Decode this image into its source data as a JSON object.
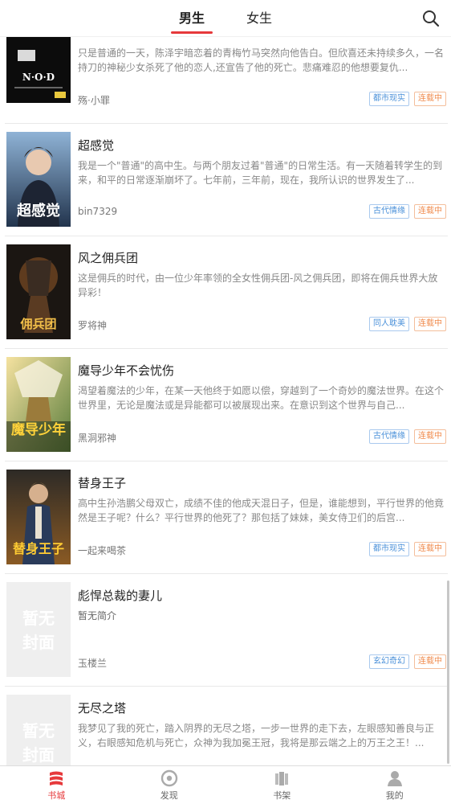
{
  "header": {
    "tabs": [
      {
        "label": "男生",
        "active": true
      },
      {
        "label": "女生",
        "active": false
      }
    ],
    "search_icon": "search-icon"
  },
  "books": [
    {
      "title": "",
      "desc": "只是普通的一天，陈泽宇暗恋着的青梅竹马突然向他告白。但欣喜还未持续多久，一名持刀的神秘少女杀死了他的恋人,还宣告了他的死亡。悲痛难忍的他想要复仇...",
      "author": "殇·小罪",
      "genre": "都市现实",
      "status": "连载中",
      "cover_text": "N·O·D"
    },
    {
      "title": "超感觉",
      "desc": "我是一个\"普通\"的高中生。与两个朋友过着\"普通\"的日常生活。有一天随着转学生的到来，和平的日常逐渐崩坏了。七年前，三年前，现在，我所认识的世界发生了...",
      "author": "bin7329",
      "genre": "古代情缘",
      "status": "连载中",
      "cover_text": "超感觉"
    },
    {
      "title": "风之佣兵团",
      "desc": "这是佣兵的时代，由一位少年率领的全女性佣兵团-风之佣兵团，即将在佣兵世界大放异彩！",
      "author": "罗将神",
      "genre": "同人耽美",
      "status": "连载中",
      "cover_text": "佣兵团"
    },
    {
      "title": "魔导少年不会忧伤",
      "desc": "渴望着魔法的少年，在某一天他终于如愿以偿，穿越到了一个奇妙的魔法世界。在这个世界里，无论是魔法或是异能都可以被展现出来。在意识到这个世界与自己...",
      "author": "黑洞邪神",
      "genre": "古代情缘",
      "status": "连载中",
      "cover_text": "魔导少年"
    },
    {
      "title": "替身王子",
      "desc": "高中生孙浩鹏父母双亡，成绩不佳的他成天混日子，但是，谁能想到，平行世界的他竟然是王子呢？什么？平行世界的他死了？那包括了妹妹，美女侍卫们的后宫...",
      "author": "一起来喝茶",
      "genre": "都市现实",
      "status": "连载中",
      "cover_text": "替身王子"
    },
    {
      "title": "彪悍总裁的妻儿",
      "desc": "暂无简介",
      "author": "玉楼兰",
      "genre": "玄幻奇幻",
      "status": "连载中",
      "cover_text": "暂无封面"
    },
    {
      "title": "无尽之塔",
      "desc": "我梦见了我的死亡，踏入阴界的无尽之塔，一步一世界的走下去，左眼感知善良与正义，右眼感知危机与死亡，众神为我加冕王冠，我将是那云端之上的万王之王！...",
      "author": "",
      "genre": "",
      "status": "",
      "cover_text": "暂无封面"
    }
  ],
  "bottom_nav": [
    {
      "label": "书城",
      "icon": "bookstore-icon",
      "active": true
    },
    {
      "label": "发现",
      "icon": "discover-icon",
      "active": false
    },
    {
      "label": "书架",
      "icon": "bookshelf-icon",
      "active": false
    },
    {
      "label": "我的",
      "icon": "profile-icon",
      "active": false
    }
  ],
  "colors": {
    "accent": "#e6393b",
    "genre_tag": "#4a90d9",
    "status_tag": "#f08a4b"
  }
}
